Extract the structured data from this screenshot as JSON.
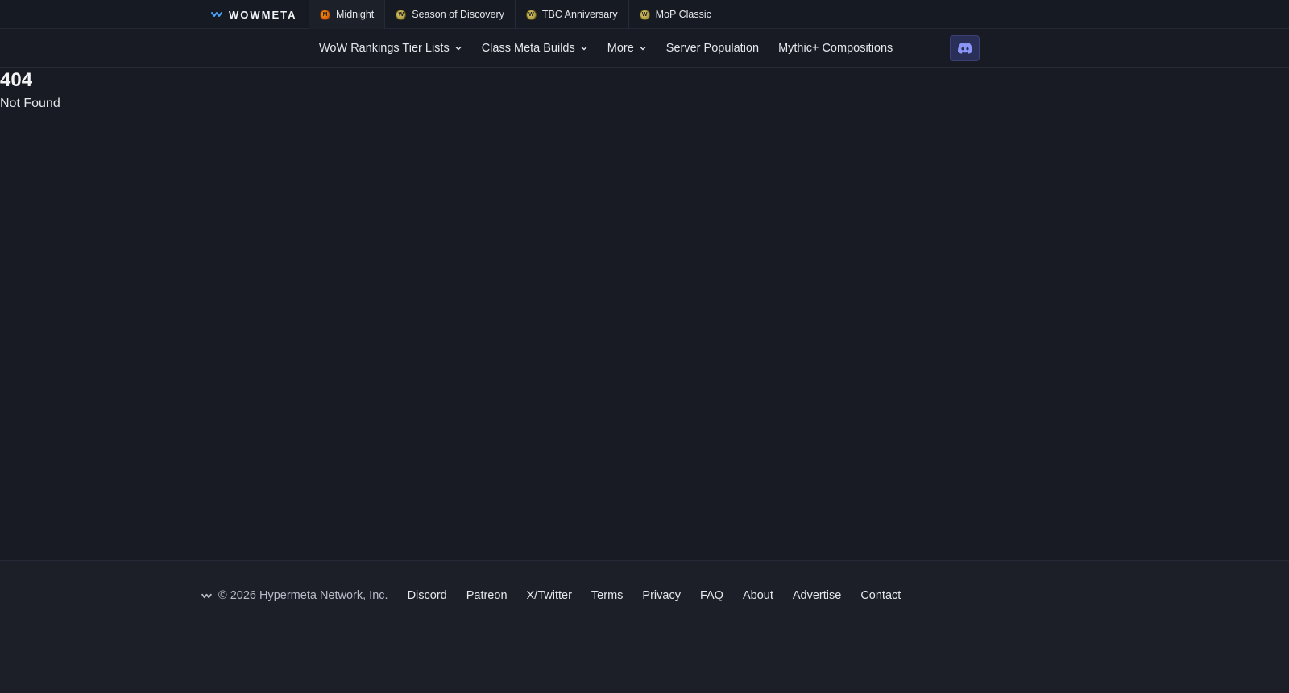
{
  "brand": {
    "name": "WOWMETA"
  },
  "game_tabs": [
    {
      "label": "Midnight",
      "icon": "midnight-badge-icon",
      "color": "#ea580c"
    },
    {
      "label": "Season of Discovery",
      "icon": "wow-badge-icon",
      "color": "#c9b44a"
    },
    {
      "label": "TBC Anniversary",
      "icon": "wow-badge-icon",
      "color": "#c9b44a"
    },
    {
      "label": "MoP Classic",
      "icon": "wow-badge-icon",
      "color": "#c9b44a"
    }
  ],
  "nav": {
    "items": [
      {
        "label": "WoW Rankings Tier Lists",
        "dropdown": true
      },
      {
        "label": "Class Meta Builds",
        "dropdown": true
      },
      {
        "label": "More",
        "dropdown": true
      },
      {
        "label": "Server Population",
        "dropdown": false
      },
      {
        "label": "Mythic+ Compositions",
        "dropdown": false
      }
    ],
    "discord_icon": "discord-icon"
  },
  "error": {
    "code": "404",
    "message": "Not Found"
  },
  "footer": {
    "copyright": "© 2026 Hypermeta Network, Inc.",
    "links": [
      "Discord",
      "Patreon",
      "X/Twitter",
      "Terms",
      "Privacy",
      "FAQ",
      "About",
      "Advertise",
      "Contact"
    ]
  },
  "colors": {
    "background": "#181b24",
    "topbar": "#161a23",
    "footer": "#1c1f28",
    "discord_accent": "#5865f2"
  }
}
